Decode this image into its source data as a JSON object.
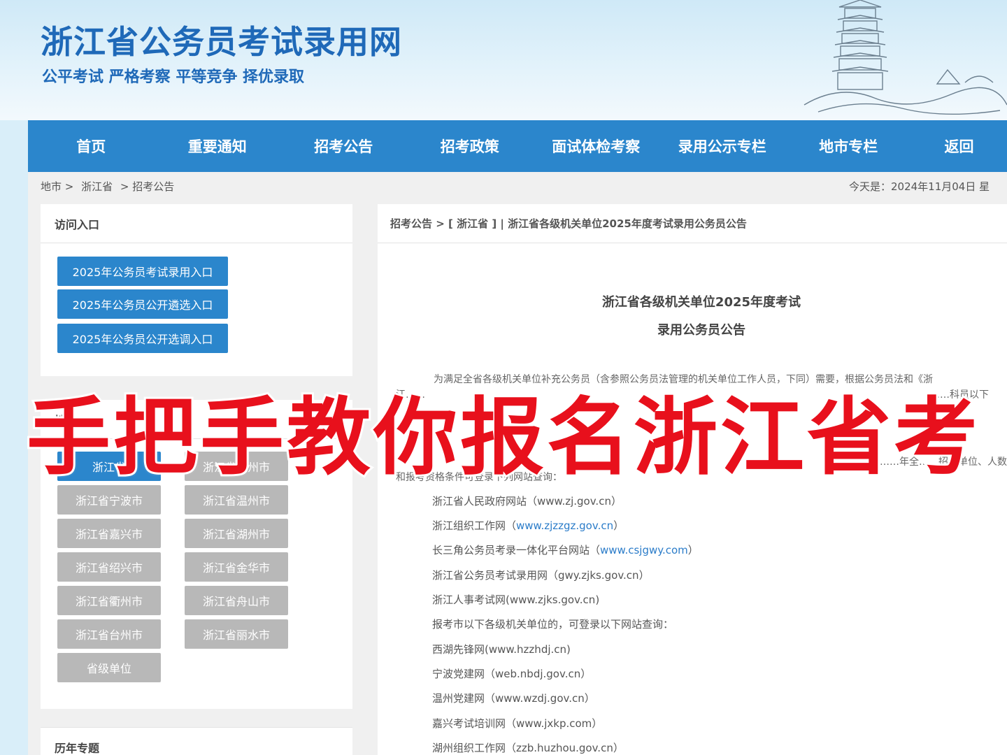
{
  "header": {
    "site_title": "浙江省公务员考试录用网",
    "slogan": "公平考试 严格考察 平等竞争 择优录取"
  },
  "nav": {
    "items": [
      "首页",
      "重要通知",
      "招考公告",
      "招考政策",
      "面试体检考察",
      "录用公示专栏",
      "地市专栏",
      "返回"
    ]
  },
  "breadcrumb": {
    "items": [
      "地市 >",
      "浙江省",
      "> 招考公告"
    ]
  },
  "today_text": "今天是：2024年11月04日 星",
  "entry_panel": {
    "title": "访问入口",
    "buttons": [
      "2025年公务员考试录用入口",
      "2025年公务员公开遴选入口",
      "2025年公务员公开选调入口"
    ]
  },
  "city_panel": {
    "title": "地市",
    "cities": [
      "浙江省",
      "浙江省杭州市",
      "浙江省宁波市",
      "浙江省温州市",
      "浙江省嘉兴市",
      "浙江省湖州市",
      "浙江省绍兴市",
      "浙江省金华市",
      "浙江省衢州市",
      "浙江省舟山市",
      "浙江省台州市",
      "浙江省丽水市",
      "省级单位"
    ]
  },
  "history_panel": {
    "title": "历年专题"
  },
  "main": {
    "breadcrumb": "招考公告 > [ 浙江省 ] | 浙江省各级机关单位2025年度考试录用公务员公告",
    "title_line1": "浙江省各级机关单位2025年度考试",
    "title_line2": "录用公务员公告",
    "para1": "为满足全省各级机关单位补充公务员（含参照公务员法管理的机关单位工作人员，下同）需要，根据公务员法和《浙",
    "para2": "江……",
    "para3_tail": "……科员以下",
    "para4": "……年全……招考单位、人数",
    "para5": "和报考资格条件可登录下列网站查询：",
    "sites": [
      {
        "name": "浙江省人民政府网站（",
        "link": "www.zj.gov.cn",
        "end": "）",
        "is_link": false
      },
      {
        "name": "浙江组织工作网（",
        "link": "www.zjzzgz.gov.cn",
        "end": "）",
        "is_link": true
      },
      {
        "name": "长三角公务员考录一体化平台网站（",
        "link": "www.csjgwy.com",
        "end": "）",
        "is_link": true
      },
      {
        "name": "浙江省公务员考试录用网（",
        "link": "gwy.zjks.gov.cn",
        "end": "）",
        "is_link": false
      },
      {
        "name": "浙江人事考试网(",
        "link": "www.zjks.gov.cn",
        "end": ")",
        "is_link": false
      },
      {
        "name": "报考市以下各级机关单位的，可登录以下网站查询：",
        "link": "",
        "end": "",
        "is_link": false
      },
      {
        "name": "西湖先锋网(",
        "link": "www.hzzhdj.cn",
        "end": ")",
        "is_link": false
      },
      {
        "name": "宁波党建网（",
        "link": "web.nbdj.gov.cn",
        "end": "）",
        "is_link": false
      },
      {
        "name": "温州党建网（",
        "link": "www.wzdj.gov.cn",
        "end": "）",
        "is_link": false
      },
      {
        "name": "嘉兴考试培训网（",
        "link": "www.jxkp.com",
        "end": "）",
        "is_link": false
      },
      {
        "name": "湖州组织工作网（",
        "link": "zzb.huzhou.gov.cn",
        "end": "）",
        "is_link": false
      }
    ]
  },
  "overlay": {
    "text": "手把手教你报名浙江省考"
  },
  "colors": {
    "brand_blue": "#2b86cc",
    "title_blue": "#1f69b8",
    "overlay_red": "#e8101c",
    "inactive_gray": "#b8b8b8"
  }
}
